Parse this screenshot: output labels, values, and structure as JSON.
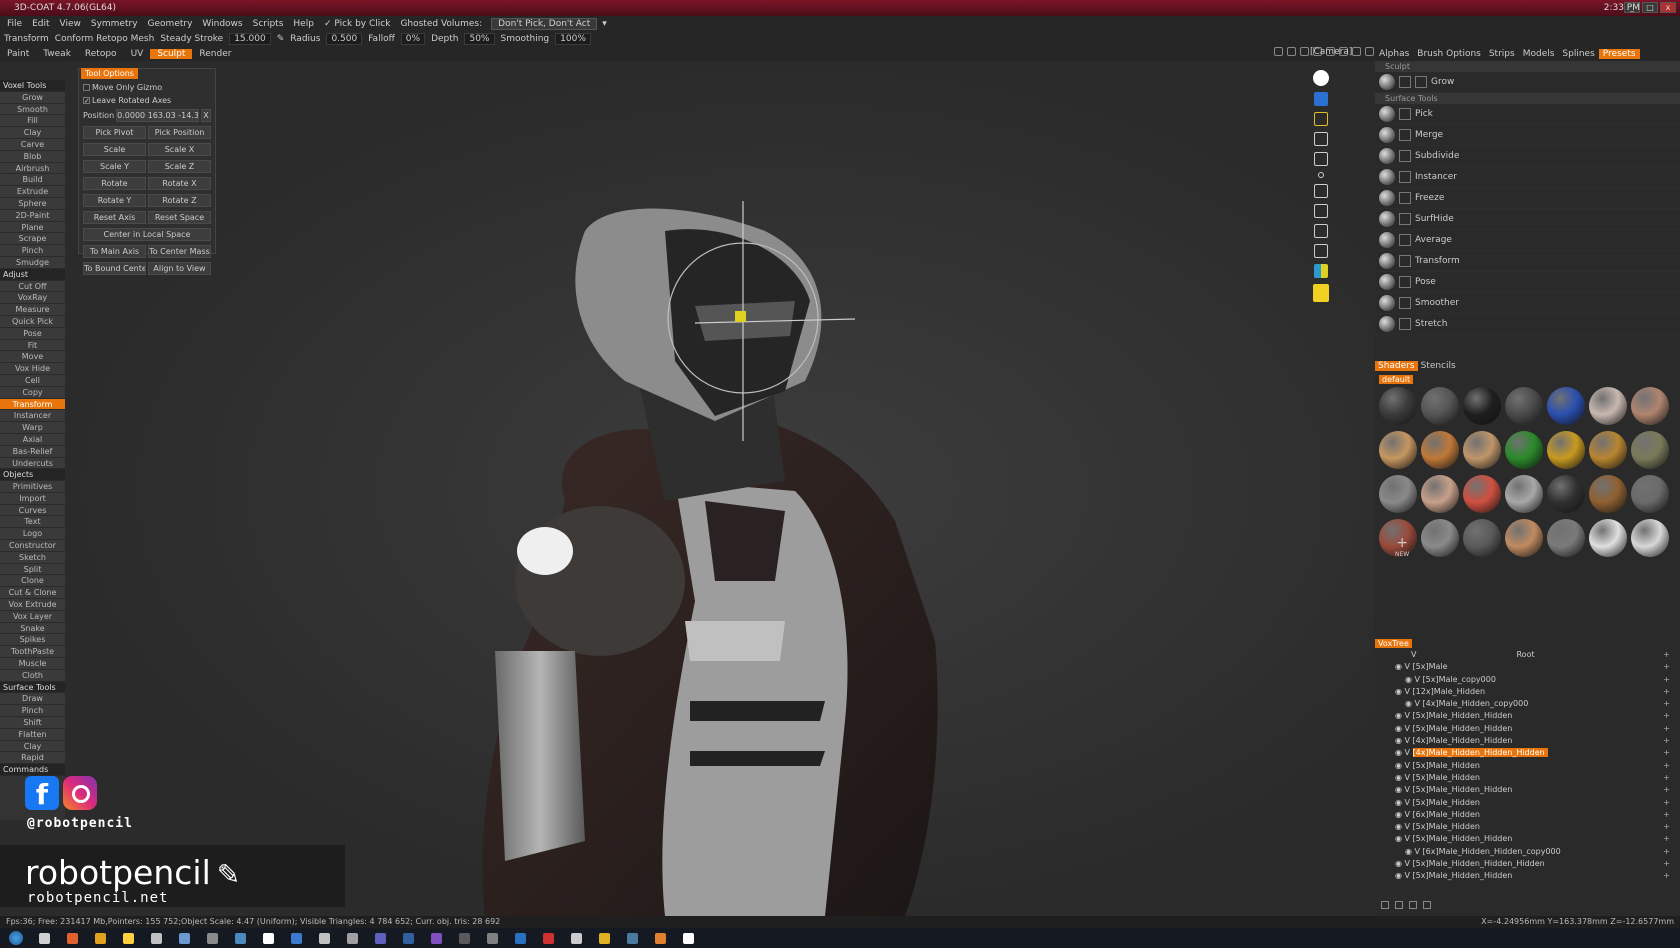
{
  "window": {
    "title": "3D-COAT 4.7.06(GL64)"
  },
  "menu": {
    "items": [
      "File",
      "Edit",
      "View",
      "Symmetry",
      "Geometry",
      "Windows",
      "Scripts",
      "Help"
    ],
    "pick_by_click": "✓ Pick by Click",
    "ghosted_volumes": "Ghosted Volumes:",
    "ghosted_value": "Don't Pick, Don't Act"
  },
  "toolbar": {
    "tool": "Transform",
    "conform": "Conform Retopo Mesh",
    "steady_stroke": "Steady Stroke",
    "steady_value": "15.000",
    "radius": "Radius",
    "radius_value": "0.500",
    "falloff": "Falloff",
    "falloff_value": "0%",
    "depth": "Depth",
    "depth_value": "50%",
    "smoothing": "Smoothing",
    "smoothing_value": "100%"
  },
  "modes": [
    "Paint",
    "Tweak",
    "Retopo",
    "UV",
    "Sculpt",
    "Render"
  ],
  "active_mode": "Sculpt",
  "camera": "[Camera]",
  "left_panel": {
    "items": [
      {
        "label": "Voxel Tools",
        "hdr": true
      },
      {
        "label": "Grow"
      },
      {
        "label": "Smooth"
      },
      {
        "label": "Fill"
      },
      {
        "label": "Clay"
      },
      {
        "label": "Carve"
      },
      {
        "label": "Blob"
      },
      {
        "label": "Airbrush"
      },
      {
        "label": "Build"
      },
      {
        "label": "Extrude"
      },
      {
        "label": "Sphere"
      },
      {
        "label": "2D-Paint"
      },
      {
        "label": "Plane"
      },
      {
        "label": "Scrape"
      },
      {
        "label": "Pinch"
      },
      {
        "label": "Smudge"
      },
      {
        "label": "Adjust",
        "hdr": true
      },
      {
        "label": "Cut Off"
      },
      {
        "label": "VoxRay"
      },
      {
        "label": "Measure"
      },
      {
        "label": "Quick Pick"
      },
      {
        "label": "Pose"
      },
      {
        "label": "Fit"
      },
      {
        "label": "Move"
      },
      {
        "label": "Vox Hide"
      },
      {
        "label": "Cell"
      },
      {
        "label": "Copy"
      },
      {
        "label": "Transform",
        "active": true
      },
      {
        "label": "Instancer"
      },
      {
        "label": "Warp"
      },
      {
        "label": "Axial"
      },
      {
        "label": "Bas-Relief"
      },
      {
        "label": "Undercuts"
      },
      {
        "label": "Objects",
        "hdr": true
      },
      {
        "label": "Primitives"
      },
      {
        "label": "Import"
      },
      {
        "label": "Curves"
      },
      {
        "label": "Text"
      },
      {
        "label": "Logo"
      },
      {
        "label": "Constructor"
      },
      {
        "label": "Sketch"
      },
      {
        "label": "Split"
      },
      {
        "label": "Clone"
      },
      {
        "label": "Cut & Clone"
      },
      {
        "label": "Vox Extrude"
      },
      {
        "label": "Vox Layer"
      },
      {
        "label": "Snake"
      },
      {
        "label": "Spikes"
      },
      {
        "label": "ToothPaste"
      },
      {
        "label": "Muscle"
      },
      {
        "label": "Cloth"
      },
      {
        "label": "Surface Tools",
        "hdr": true
      },
      {
        "label": "Draw"
      },
      {
        "label": "Pinch"
      },
      {
        "label": "Shift"
      },
      {
        "label": "Flatten"
      },
      {
        "label": "Clay"
      },
      {
        "label": "Rapid"
      },
      {
        "label": "Commands",
        "hdr": true
      }
    ]
  },
  "tool_options": {
    "title": "Tool Options",
    "move_only_gizmo": "Move Only Gizmo",
    "leave_rotated_axes": "Leave Rotated Axes",
    "position_label": "Position",
    "position_value": "0.0000 163.03 -14.35",
    "position_clear": "X",
    "pick_pivot": "Pick Pivot",
    "pick_position": "Pick Position",
    "scale": "Scale",
    "scale_x": "Scale X",
    "scale_y": "Scale Y",
    "scale_z": "Scale Z",
    "rotate": "Rotate",
    "rotate_x": "Rotate X",
    "rotate_y": "Rotate Y",
    "rotate_z": "Rotate Z",
    "reset_axis": "Reset Axis",
    "reset_space": "Reset Space",
    "center_local": "Center in Local Space",
    "to_main_axis": "To Main Axis",
    "to_center_mass": "To Center Mass",
    "to_bound_center": "To Bound Cente",
    "align_to_view": "Align to View"
  },
  "right_panel": {
    "tabs": [
      "Alphas",
      "Brush Options",
      "Strips",
      "Models",
      "Splines",
      "Presets"
    ],
    "active_tab": "Presets",
    "sculpt_header": "Sculpt",
    "grow": "Grow",
    "surface_header": "Surface Tools",
    "brushes": [
      "Pick",
      "Merge",
      "Subdivide",
      "Instancer",
      "Freeze",
      "SurfHide",
      "Average",
      "Transform",
      "Pose",
      "Smoother",
      "Stretch"
    ],
    "shaders_tab": "Shaders",
    "stencils_tab": "Stencils",
    "default_label": "default",
    "new_label": "NEW",
    "shader_colors": [
      "#3a3a3a",
      "#555555",
      "#1f1f1f",
      "#4a4a4a",
      "#2a4fb0",
      "#c9b8b0",
      "#b08570",
      "#c69660",
      "#c07838",
      "#c0956a",
      "#2a8a2a",
      "#c89a20",
      "#b88530",
      "#7a7a5a",
      "#8a8a8a",
      "#c8a08a",
      "#d05040",
      "#a8a8a8",
      "#303030",
      "#906030",
      "#6a6a6a",
      "#9a4a3a",
      "#8a8a8a",
      "#5a5a5a",
      "#c08a60",
      "#7a7a7a",
      "#e0e0e0",
      "#d8d8d8"
    ]
  },
  "voxtree": {
    "title": "VoxTree",
    "root": "Root",
    "rows": [
      {
        "label": "[5x]Male",
        "indent": 0
      },
      {
        "label": "[5x]Male_copy000",
        "indent": 1
      },
      {
        "label": "[12x]Male_Hidden",
        "indent": 0
      },
      {
        "label": "[4x]Male_Hidden_copy000",
        "indent": 1
      },
      {
        "label": "[5x]Male_Hidden_Hidden",
        "indent": 0
      },
      {
        "label": "[5x]Male_Hidden_Hidden",
        "indent": 0
      },
      {
        "label": "[4x]Male_Hidden_Hidden",
        "indent": 0
      },
      {
        "label": "[4x]Male_Hidden_Hidden_Hidden",
        "indent": 0,
        "active": true
      },
      {
        "label": "[5x]Male_Hidden",
        "indent": 0
      },
      {
        "label": "[5x]Male_Hidden",
        "indent": 0
      },
      {
        "label": "[5x]Male_Hidden_Hidden",
        "indent": 0
      },
      {
        "label": "[5x]Male_Hidden",
        "indent": 0
      },
      {
        "label": "[6x]Male_Hidden",
        "indent": 0
      },
      {
        "label": "[5x]Male_Hidden",
        "indent": 0
      },
      {
        "label": "[5x]Male_Hidden_Hidden",
        "indent": 0
      },
      {
        "label": "[6x]Male_Hidden_Hidden_copy000",
        "indent": 1
      },
      {
        "label": "[5x]Male_Hidden_Hidden_Hidden",
        "indent": 0
      },
      {
        "label": "[5x]Male_Hidden_Hidden",
        "indent": 0
      }
    ]
  },
  "status": {
    "left": "Fps:36;   Free: 231417 Mb,Pointers: 155 752;Object Scale: 4.47 (Uniform); Visible Triangles: 4 784 652; Curr. obj. tris: 28 692",
    "right": "X=-4.24956mm Y=163.378mm Z=-12.6577mm"
  },
  "taskbar": {
    "time": "2:33 PM",
    "icon_colors": [
      "#d0d0d0",
      "#e06030",
      "#e0a020",
      "#ffd040",
      "#c0c0c0",
      "#6a9ad0",
      "#8a8a8a",
      "#4a8ac0",
      "#ffffff",
      "#3a7ad0",
      "#c0c0c0",
      "#a0a0a0",
      "#6060c0",
      "#3060a0",
      "#8050c0",
      "#5a5a5a",
      "#808080",
      "#2a70c0",
      "#d03030",
      "#cccccc",
      "#e0b020",
      "#4a7aa0",
      "#e08030",
      "#ffffff"
    ]
  },
  "branding": {
    "handle": "@robotpencil",
    "name": "robotpencil",
    "url": "robotpencil.net",
    "pencil_icon": "pencil-icon"
  },
  "accent": "#e8740c"
}
